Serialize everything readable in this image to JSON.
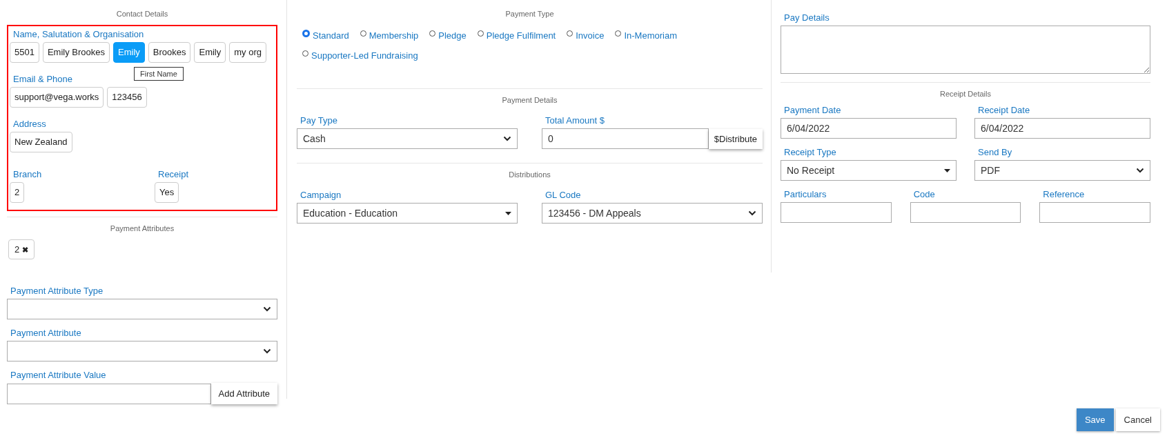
{
  "contact": {
    "heading": "Contact Details",
    "highlighted": true,
    "groups": [
      {
        "label": "Name, Salutation & Organisation",
        "chips": [
          {
            "text": "5501",
            "selected": false
          },
          {
            "text": "Emily Brookes",
            "selected": false
          },
          {
            "text": "Emily",
            "selected": true,
            "tooltip": "First Name"
          },
          {
            "text": "Brookes",
            "selected": false
          },
          {
            "text": "Emily",
            "selected": false
          },
          {
            "text": "my org",
            "selected": false
          }
        ]
      },
      {
        "label": "Email & Phone",
        "chips": [
          {
            "text": "support@vega.works",
            "selected": false
          },
          {
            "text": "123456",
            "selected": false
          }
        ]
      },
      {
        "label": "Address",
        "chips": [
          {
            "text": "New Zealand",
            "selected": false
          }
        ]
      }
    ],
    "pairs": [
      {
        "label": "Branch",
        "chips": [
          {
            "text": "2",
            "selected": false
          }
        ]
      },
      {
        "label": "Receipt",
        "chips": [
          {
            "text": "Yes",
            "selected": false
          }
        ]
      }
    ]
  },
  "payment_attributes": {
    "heading": "Payment Attributes",
    "tags": [
      {
        "text": "2",
        "remove": "✖"
      }
    ],
    "fields": [
      {
        "label": "Payment Attribute Type",
        "kind": "chevron"
      },
      {
        "label": "Payment Attribute",
        "kind": "chevron"
      }
    ],
    "value_field": {
      "label": "Payment Attribute Value"
    },
    "add_button": "Add Attribute"
  },
  "payment_type": {
    "heading": "Payment Type",
    "options": [
      {
        "label": "Standard",
        "selected": true
      },
      {
        "label": "Membership",
        "selected": false
      },
      {
        "label": "Pledge",
        "selected": false
      },
      {
        "label": "Pledge Fulfilment",
        "selected": false
      },
      {
        "label": "Invoice",
        "selected": false
      },
      {
        "label": "In-Memoriam",
        "selected": false
      },
      {
        "label": "Supporter-Led Fundraising",
        "selected": false
      }
    ]
  },
  "payment_details": {
    "heading": "Payment Details",
    "pay_type": {
      "label": "Pay Type",
      "value": "Cash",
      "kind": "chevron"
    },
    "total_amount": {
      "label": "Total Amount $",
      "value": "0"
    },
    "distribute_button": "$Distribute"
  },
  "distributions": {
    "heading": "Distributions",
    "fields": [
      {
        "label": "Campaign",
        "value": "Education - Education",
        "kind": "caret"
      },
      {
        "label": "GL Code",
        "value": "123456 - DM Appeals",
        "kind": "chevron"
      }
    ]
  },
  "pay_details": {
    "label": "Pay Details"
  },
  "receipt_details": {
    "heading": "Receipt Details",
    "rows": [
      [
        {
          "label": "Payment Date",
          "value": "6/04/2022",
          "kind": "text"
        },
        {
          "label": "Receipt Date",
          "value": "6/04/2022",
          "kind": "text"
        }
      ],
      [
        {
          "label": "Receipt Type",
          "value": "No Receipt",
          "kind": "caret"
        },
        {
          "label": "Send By",
          "value": "PDF",
          "kind": "chevron"
        }
      ],
      [
        {
          "label": "Particulars",
          "kind": "text"
        },
        {
          "label": "Code",
          "kind": "text"
        },
        {
          "label": "Reference",
          "kind": "text"
        }
      ]
    ]
  },
  "footer": {
    "buttons": [
      {
        "label": "Save",
        "kind": "primary"
      },
      {
        "label": "Cancel",
        "kind": "secondary"
      }
    ]
  }
}
